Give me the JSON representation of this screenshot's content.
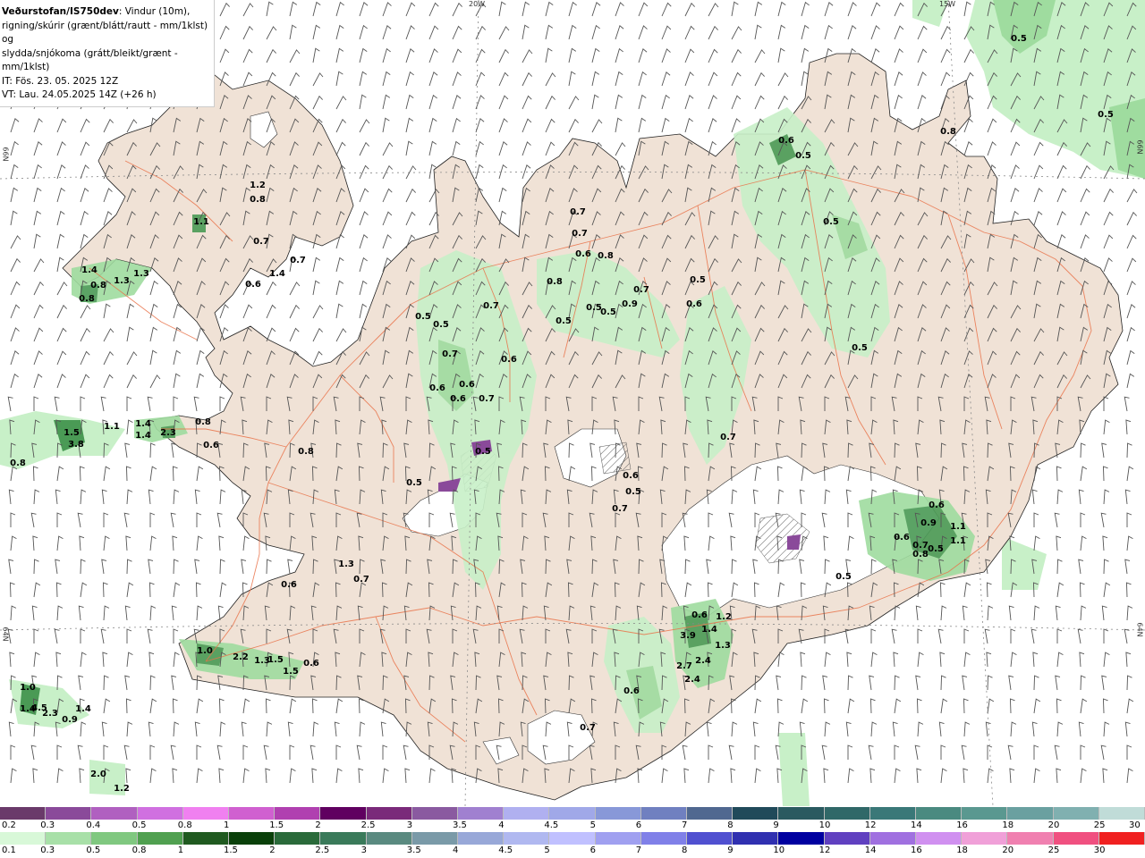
{
  "header": {
    "title": "Veðurstofan/IS750dev",
    "title_suffix": ": Vindur (10m),",
    "line2": "rigning/skúrir (grænt/blátt/rautt - mm/1klst) og",
    "line3": "slydda/snjókoma (grátt/bleikt/grænt - mm/1klst)",
    "line4": "IT: Fös. 23. 05. 2025 12Z",
    "line5": "VT: Lau. 24.05.2025 14Z (+26 h)"
  },
  "graticule": {
    "lon_labels": [
      "20W",
      "15W"
    ],
    "lat_labels": [
      "66N",
      "64N"
    ]
  },
  "colors": {
    "ocean": "#ffffff",
    "land": "#f0e2d6",
    "glacier": "#ffffff",
    "roads": "#e9734a",
    "precip_light": "#c8f0c8",
    "precip_mid": "#9fdc9f",
    "precip_dark": "#4a9a55",
    "sleet_purple": "#8a4a9a",
    "wind_barb": "#555555"
  },
  "precip_labels": [
    {
      "text": "1.2"
    },
    {
      "text": "0.8"
    },
    {
      "text": "1.1"
    },
    {
      "text": "0.7"
    },
    {
      "text": "0.7"
    },
    {
      "text": "1.4"
    },
    {
      "text": "1.3"
    },
    {
      "text": "0.8"
    },
    {
      "text": "1.3"
    },
    {
      "text": "0.6"
    },
    {
      "text": "1.4"
    },
    {
      "text": "0.8"
    },
    {
      "text": "1.5"
    },
    {
      "text": "1.1"
    },
    {
      "text": "1.4"
    },
    {
      "text": "1.4"
    },
    {
      "text": "2.3"
    },
    {
      "text": "0.8"
    },
    {
      "text": "3.8"
    },
    {
      "text": "0.6"
    },
    {
      "text": "0.8"
    },
    {
      "text": "0.8"
    },
    {
      "text": "0.5"
    },
    {
      "text": "0.5"
    },
    {
      "text": "0.5"
    },
    {
      "text": "0.7"
    },
    {
      "text": "0.7"
    },
    {
      "text": "0.6"
    },
    {
      "text": "0.6"
    },
    {
      "text": "0.6"
    },
    {
      "text": "0.6"
    },
    {
      "text": "0.7"
    },
    {
      "text": "0.7"
    },
    {
      "text": "0.7"
    },
    {
      "text": "0.6"
    },
    {
      "text": "0.8"
    },
    {
      "text": "0.8"
    },
    {
      "text": "0.5"
    },
    {
      "text": "0.5"
    },
    {
      "text": "0.5"
    },
    {
      "text": "0.9"
    },
    {
      "text": "0.7"
    },
    {
      "text": "0.5"
    },
    {
      "text": "0.6"
    },
    {
      "text": "0.6"
    },
    {
      "text": "0.5"
    },
    {
      "text": "0.5"
    },
    {
      "text": "0.5"
    },
    {
      "text": "0.8"
    },
    {
      "text": "0.5"
    },
    {
      "text": "0.5"
    },
    {
      "text": "0.5"
    },
    {
      "text": "0.7"
    },
    {
      "text": "0.6"
    },
    {
      "text": "0.5"
    },
    {
      "text": "0.7"
    },
    {
      "text": "0.6"
    },
    {
      "text": "0.9"
    },
    {
      "text": "1.1"
    },
    {
      "text": "1.1"
    },
    {
      "text": "0.6"
    },
    {
      "text": "0.7"
    },
    {
      "text": "0.8"
    },
    {
      "text": "0.5"
    },
    {
      "text": "0.5"
    },
    {
      "text": "1.3"
    },
    {
      "text": "0.7"
    },
    {
      "text": "0.6"
    },
    {
      "text": "0.6"
    },
    {
      "text": "1.2"
    },
    {
      "text": "3.9"
    },
    {
      "text": "1.4"
    },
    {
      "text": "1.3"
    },
    {
      "text": "2.7"
    },
    {
      "text": "2.4"
    },
    {
      "text": "2.4"
    },
    {
      "text": "0.6"
    },
    {
      "text": "0.7"
    },
    {
      "text": "1.0"
    },
    {
      "text": "2.2"
    },
    {
      "text": "1.3"
    },
    {
      "text": "1.5"
    },
    {
      "text": "1.5"
    },
    {
      "text": "0.6"
    },
    {
      "text": "1.0"
    },
    {
      "text": "1.4"
    },
    {
      "text": "4.5"
    },
    {
      "text": "2.3"
    },
    {
      "text": "1.4"
    },
    {
      "text": "0.9"
    },
    {
      "text": "2.0"
    },
    {
      "text": "1.2"
    }
  ],
  "legend_top": {
    "labels": [
      "0.2",
      "0.3",
      "0.4",
      "0.5",
      "0.8",
      "1",
      "1.5",
      "2",
      "2.5",
      "3",
      "3.5",
      "4",
      "4.5",
      "5",
      "6",
      "7",
      "8",
      "9",
      "10",
      "12",
      "14",
      "16",
      "18",
      "20",
      "25",
      "30"
    ],
    "colors": [
      "#6a3a6a",
      "#8a4a9a",
      "#b060c0",
      "#d070e0",
      "#f080f0",
      "#d060d0",
      "#b040b0",
      "#600060",
      "#7a2a7a",
      "#8a5aa0",
      "#a080d0",
      "#b0b0f0",
      "#a0a8e8",
      "#8898d8",
      "#7080c0",
      "#506890",
      "#204a5a",
      "#2a5a60",
      "#306868",
      "#3a7878",
      "#4a8a80",
      "#5a9890",
      "#6aa0a0",
      "#80b0b0",
      "#c0dcd8"
    ]
  },
  "legend_bottom": {
    "labels": [
      "0.1",
      "0.3",
      "0.5",
      "0.8",
      "1",
      "1.5",
      "2",
      "2.5",
      "3",
      "3.5",
      "4",
      "4.5",
      "5",
      "6",
      "7",
      "8",
      "9",
      "10",
      "12",
      "14",
      "16",
      "18",
      "20",
      "25",
      "30"
    ],
    "colors": [
      "#d8f8d8",
      "#a8e0a8",
      "#80c880",
      "#50a050",
      "#205a20",
      "#0a400a",
      "#2a6a3a",
      "#3a7a5a",
      "#5a8a80",
      "#7a9aa8",
      "#98a8d8",
      "#b0b8f0",
      "#c0c0ff",
      "#a0a0f0",
      "#8080e8",
      "#5050d0",
      "#3030b0",
      "#0000a0",
      "#6040c0",
      "#a070e0",
      "#d090f0",
      "#f0a0d8",
      "#f080b0",
      "#f05080",
      "#f02020"
    ]
  }
}
